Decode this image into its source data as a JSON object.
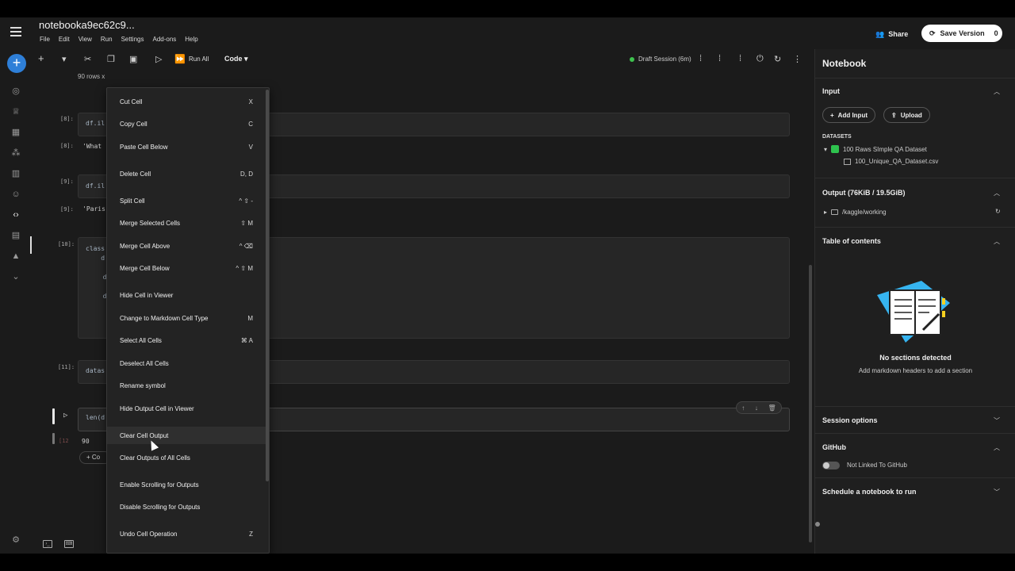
{
  "app": {
    "notebook_title": "notebooka9ec62c9...",
    "menu": [
      "File",
      "Edit",
      "View",
      "Run",
      "Settings",
      "Add-ons",
      "Help"
    ],
    "share_label": "Share",
    "save_version_label": "Save Version",
    "save_version_count": "0",
    "accent_color": "#2e7fd8"
  },
  "toolbar": {
    "run_all_label": "Run All",
    "cell_type_label": "Code",
    "session_label": "Draft Session (6m)",
    "session_status_color": "#3ec24e"
  },
  "notebook": {
    "rows_text": "90 rows x",
    "cells": [
      {
        "prompt": "[8]:",
        "code": "df.il",
        "output_prompt": "[8]:",
        "output": "'What"
      },
      {
        "prompt": "[9]:",
        "code": "df.il",
        "output_prompt": "[9]:",
        "output": "'Paris"
      },
      {
        "prompt": "[10]:",
        "code_lines": [
          "class",
          "    d",
          "  d",
          "  d"
        ]
      },
      {
        "prompt": "[11]:",
        "code": "datas"
      },
      {
        "prompt": "",
        "code": "len(d",
        "output_prompt": "[12",
        "output": "90"
      }
    ],
    "add_code_label": "+ Co"
  },
  "context_menu": {
    "items": [
      {
        "label": "Cut Cell",
        "shortcut": "X"
      },
      {
        "label": "Copy Cell",
        "shortcut": "C"
      },
      {
        "label": "Paste Cell Below",
        "shortcut": "V"
      },
      {
        "label": "Delete Cell",
        "shortcut": "D, D"
      },
      {
        "label": "Split Cell",
        "shortcut": "^ ⇧ -"
      },
      {
        "label": "Merge Selected Cells",
        "shortcut": "⇧ M"
      },
      {
        "label": "Merge Cell Above",
        "shortcut": "^ ⌫"
      },
      {
        "label": "Merge Cell Below",
        "shortcut": "^ ⇧ M"
      },
      {
        "label": "Hide Cell in Viewer",
        "shortcut": ""
      },
      {
        "label": "Change to Markdown Cell Type",
        "shortcut": "M"
      },
      {
        "label": "Select All Cells",
        "shortcut": "⌘ A"
      },
      {
        "label": "Deselect All Cells",
        "shortcut": ""
      },
      {
        "label": "Rename symbol",
        "shortcut": ""
      },
      {
        "label": "Hide Output Cell in Viewer",
        "shortcut": ""
      },
      {
        "label": "Clear Cell Output",
        "shortcut": ""
      },
      {
        "label": "Clear Outputs of All Cells",
        "shortcut": ""
      },
      {
        "label": "Enable Scrolling for Outputs",
        "shortcut": ""
      },
      {
        "label": "Disable Scrolling for Outputs",
        "shortcut": ""
      },
      {
        "label": "Undo Cell Operation",
        "shortcut": "Z"
      }
    ]
  },
  "right_panel": {
    "title": "Notebook",
    "input_section": "Input",
    "add_input_label": "Add Input",
    "upload_label": "Upload",
    "datasets_label": "DATASETS",
    "dataset_name": "100 Raws SImple QA Dataset",
    "dataset_file": "100_Unique_QA_Dataset.csv",
    "output_section": "Output (76KiB / 19.5GiB)",
    "output_path": "/kaggle/working",
    "toc_section": "Table of contents",
    "no_sections_title": "No sections detected",
    "no_sections_sub": "Add markdown headers to add a section",
    "session_options": "Session options",
    "github_section": "GitHub",
    "github_status": "Not Linked To GitHub",
    "schedule_section": "Schedule a notebook to run"
  }
}
